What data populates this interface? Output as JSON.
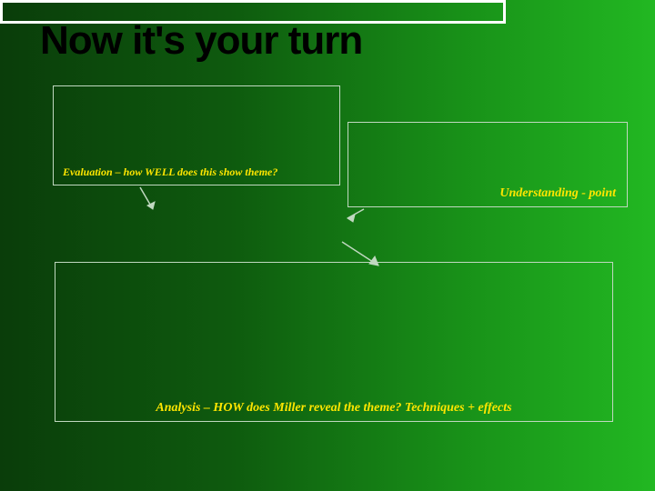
{
  "title": "Now it's your turn",
  "boxes": {
    "evaluation": {
      "label": "Evaluation – how WELL does this show theme?"
    },
    "understanding": {
      "label": "Understanding - point"
    },
    "analysis": {
      "label": "Analysis – HOW does Miller reveal the theme? Techniques + effects"
    }
  }
}
